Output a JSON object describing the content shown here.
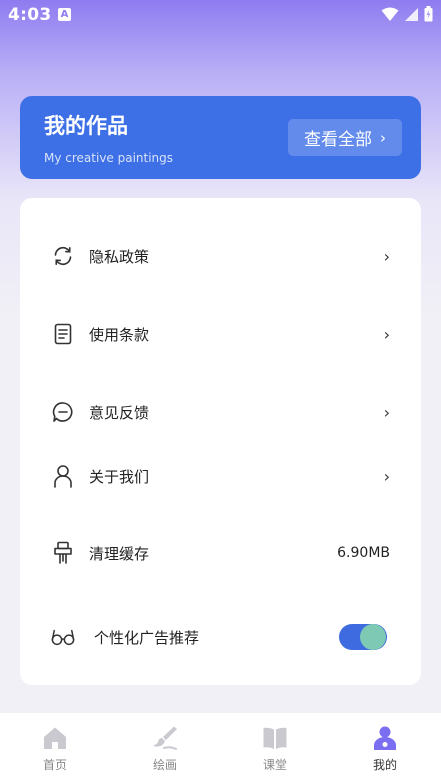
{
  "status_bar": {
    "time": "4:03",
    "badge": "A"
  },
  "works": {
    "title": "我的作品",
    "subtitle": "My creative paintings",
    "view_all": "查看全部",
    "chevron": "›"
  },
  "settings": [
    {
      "label": "隐私政策",
      "icon": "refresh-icon",
      "arrow": "›"
    },
    {
      "label": "使用条款",
      "icon": "document-icon",
      "arrow": "›"
    },
    {
      "label": "意见反馈",
      "icon": "chat-bubble-icon",
      "arrow": "›"
    },
    {
      "label": "关于我们",
      "icon": "user-icon",
      "arrow": "›"
    },
    {
      "label": "清理缓存",
      "icon": "brush-icon",
      "value": "6.90MB"
    },
    {
      "label": "个性化广告推荐",
      "icon": "glasses-icon",
      "toggle_on": true
    }
  ],
  "nav": [
    {
      "label": "首页",
      "icon": "home-icon"
    },
    {
      "label": "绘画",
      "icon": "paint-brush-icon"
    },
    {
      "label": "课堂",
      "icon": "book-icon"
    },
    {
      "label": "我的",
      "icon": "profile-icon",
      "active": true
    }
  ],
  "colors": {
    "accent": "#3d6fe6",
    "toggle_knob": "#7ec9b4",
    "active_nav": "#7b6ef0",
    "inactive_nav": "#c9c9cf"
  }
}
